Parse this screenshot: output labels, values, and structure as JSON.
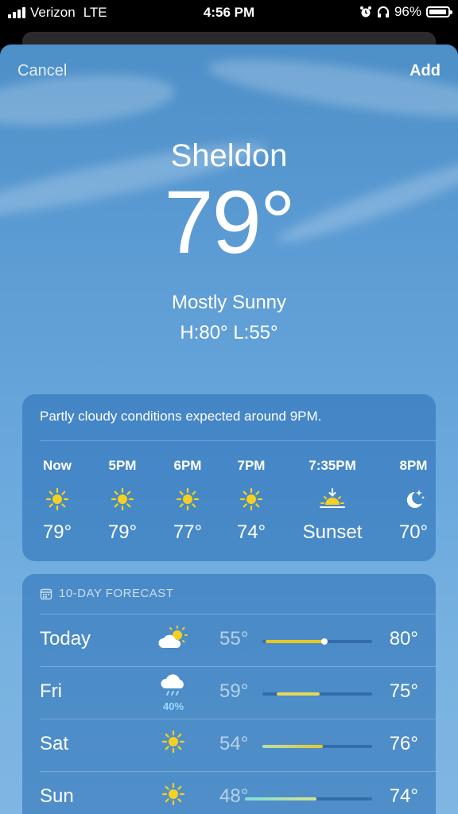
{
  "status": {
    "carrier": "Verizon",
    "network": "LTE",
    "time": "4:56 PM",
    "battery": "96%"
  },
  "nav": {
    "cancel": "Cancel",
    "add": "Add"
  },
  "current": {
    "city": "Sheldon",
    "temp": "79°",
    "condition": "Mostly Sunny",
    "hilo": "H:80°  L:55°"
  },
  "hourly": {
    "summary": "Partly cloudy conditions expected around 9PM.",
    "items": [
      {
        "time": "Now",
        "icon": "sun-icon",
        "value": "79°"
      },
      {
        "time": "5PM",
        "icon": "sun-icon",
        "value": "79°"
      },
      {
        "time": "6PM",
        "icon": "sun-icon",
        "value": "77°"
      },
      {
        "time": "7PM",
        "icon": "sun-icon",
        "value": "74°"
      },
      {
        "time": "7:35PM",
        "icon": "sunset-icon",
        "value": "Sunset"
      },
      {
        "time": "8PM",
        "icon": "moon-stars-icon",
        "value": "70°"
      }
    ]
  },
  "daily": {
    "header": "10-DAY FORECAST",
    "days": [
      {
        "name": "Today",
        "icon": "partly-cloudy-icon",
        "precip": "",
        "low": "55°",
        "high": "80°"
      },
      {
        "name": "Fri",
        "icon": "rain-cloud-icon",
        "precip": "40%",
        "low": "59°",
        "high": "75°"
      },
      {
        "name": "Sat",
        "icon": "sun-icon",
        "precip": "",
        "low": "54°",
        "high": "76°"
      },
      {
        "name": "Sun",
        "icon": "sun-icon",
        "precip": "",
        "low": "48°",
        "high": "74°"
      }
    ]
  },
  "colors": {
    "sun": "#f5d020",
    "bar_warm": "#e6c822",
    "bar_cool": "#8fe0d0",
    "precip": "#9fd7ff"
  }
}
